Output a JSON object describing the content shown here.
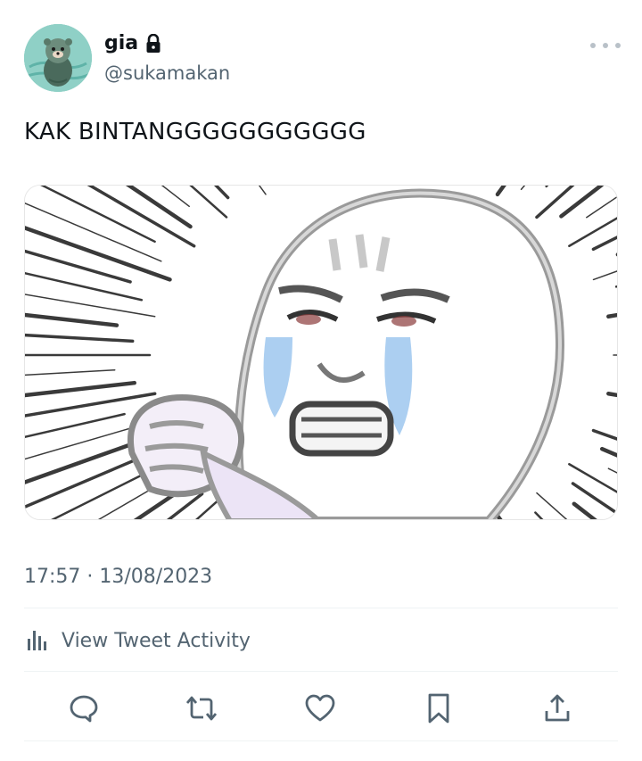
{
  "author": {
    "display_name": "gia",
    "handle": "@sukamakan",
    "avatar_icon": "otter-avatar",
    "locked_icon": "lock-icon"
  },
  "tweet": {
    "text": "KAK BINTANGGGGGGGGGGG",
    "media_description_icon": "crying-meme-face-image",
    "timestamp": "17:57 · 13/08/2023"
  },
  "activity": {
    "label": "View Tweet Activity",
    "icon": "bar-chart-icon"
  },
  "actions": [
    {
      "name": "reply",
      "icon": "speech-bubble-icon"
    },
    {
      "name": "retweet",
      "icon": "retweet-icon"
    },
    {
      "name": "like",
      "icon": "heart-icon"
    },
    {
      "name": "bookmark",
      "icon": "bookmark-icon"
    },
    {
      "name": "share",
      "icon": "share-icon"
    }
  ],
  "colors": {
    "text_primary": "#0f1419",
    "text_secondary": "#536471",
    "divider": "#eff3f4",
    "icon": "#536471"
  }
}
